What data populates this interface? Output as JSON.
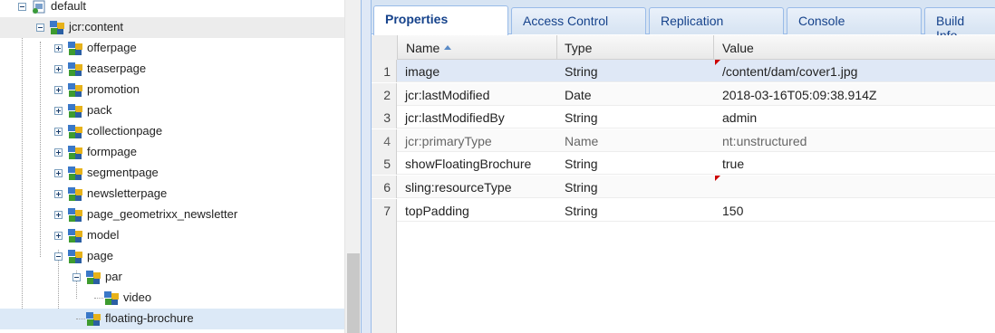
{
  "tree": {
    "items": [
      {
        "label": "default",
        "depth": 0,
        "toggle": "minus",
        "icon": "page-node-icon",
        "state": ""
      },
      {
        "label": "jcr:content",
        "depth": 1,
        "toggle": "minus",
        "icon": "content-node-icon",
        "state": "hover"
      },
      {
        "label": "offerpage",
        "depth": 2,
        "toggle": "plus",
        "icon": "content-node-icon",
        "state": ""
      },
      {
        "label": "teaserpage",
        "depth": 2,
        "toggle": "plus",
        "icon": "content-node-icon",
        "state": ""
      },
      {
        "label": "promotion",
        "depth": 2,
        "toggle": "plus",
        "icon": "content-node-icon",
        "state": ""
      },
      {
        "label": "pack",
        "depth": 2,
        "toggle": "plus",
        "icon": "content-node-icon",
        "state": ""
      },
      {
        "label": "collectionpage",
        "depth": 2,
        "toggle": "plus",
        "icon": "content-node-icon",
        "state": ""
      },
      {
        "label": "formpage",
        "depth": 2,
        "toggle": "plus",
        "icon": "content-node-icon",
        "state": ""
      },
      {
        "label": "segmentpage",
        "depth": 2,
        "toggle": "plus",
        "icon": "content-node-icon",
        "state": ""
      },
      {
        "label": "newsletterpage",
        "depth": 2,
        "toggle": "plus",
        "icon": "content-node-icon",
        "state": ""
      },
      {
        "label": "page_geometrixx_newsletter",
        "depth": 2,
        "toggle": "plus",
        "icon": "content-node-icon",
        "state": ""
      },
      {
        "label": "model",
        "depth": 2,
        "toggle": "plus",
        "icon": "content-node-icon",
        "state": ""
      },
      {
        "label": "page",
        "depth": 2,
        "toggle": "minus",
        "icon": "content-node-icon",
        "state": ""
      },
      {
        "label": "par",
        "depth": 3,
        "toggle": "minus",
        "icon": "content-node-icon",
        "state": ""
      },
      {
        "label": "video",
        "depth": 4,
        "toggle": "none",
        "icon": "content-node-icon",
        "state": ""
      },
      {
        "label": "floating-brochure",
        "depth": 3,
        "toggle": "none",
        "icon": "content-node-icon",
        "state": "selected"
      }
    ]
  },
  "tabs": [
    {
      "label": "Properties",
      "active": true
    },
    {
      "label": "Access Control",
      "active": false
    },
    {
      "label": "Replication",
      "active": false
    },
    {
      "label": "Console",
      "active": false
    },
    {
      "label": "Build Info",
      "active": false
    }
  ],
  "grid": {
    "columns": {
      "name": "Name",
      "type": "Type",
      "value": "Value"
    },
    "rows": [
      {
        "num": "1",
        "name": "image",
        "type": "String",
        "value": "/content/dam/cover1.jpg",
        "dirty": true,
        "protected": false,
        "selected": true
      },
      {
        "num": "2",
        "name": "jcr:lastModified",
        "type": "Date",
        "value": "2018-03-16T05:09:38.914Z",
        "dirty": false,
        "protected": false,
        "selected": false
      },
      {
        "num": "3",
        "name": "jcr:lastModifiedBy",
        "type": "String",
        "value": "admin",
        "dirty": false,
        "protected": false,
        "selected": false
      },
      {
        "num": "4",
        "name": "jcr:primaryType",
        "type": "Name",
        "value": "nt:unstructured",
        "dirty": false,
        "protected": true,
        "selected": false
      },
      {
        "num": "5",
        "name": "showFloatingBrochure",
        "type": "String",
        "value": "true",
        "dirty": false,
        "protected": false,
        "selected": false
      },
      {
        "num": "6",
        "name": "sling:resourceType",
        "type": "String",
        "value": "",
        "dirty": true,
        "protected": false,
        "selected": false
      },
      {
        "num": "7",
        "name": "topPadding",
        "type": "String",
        "value": "150",
        "dirty": false,
        "protected": false,
        "selected": false
      }
    ]
  },
  "colors": {
    "tab_text": "#15428b",
    "selection": "#dce9f7",
    "dirty_marker": "#cc0000"
  }
}
